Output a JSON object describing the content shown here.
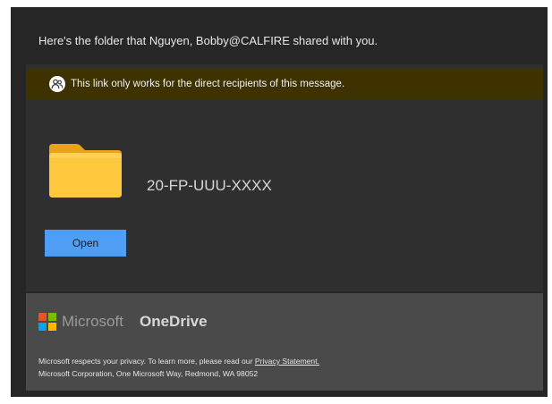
{
  "header": {
    "text": "Here's the folder that Nguyen, Bobby@CALFIRE shared with you."
  },
  "notice": {
    "icon": "people-icon",
    "text": "This link only works for the direct recipients of this message.",
    "background": "#3d3200"
  },
  "item": {
    "icon": "folder-icon",
    "name": "20-FP-UUU-XXXX",
    "folder_color": "#ffc83d"
  },
  "actions": {
    "open_label": "Open",
    "open_color": "#4f9ef6"
  },
  "footer": {
    "brand_company": "Microsoft",
    "brand_product": "OneDrive",
    "logo_colors": [
      "#f25022",
      "#7fba00",
      "#00a4ef",
      "#ffb900"
    ],
    "privacy_prefix": "Microsoft respects your privacy. To learn more, please read our ",
    "privacy_link": "Privacy Statement.",
    "address": "Microsoft Corporation, One Microsoft Way, Redmond, WA 98052"
  }
}
